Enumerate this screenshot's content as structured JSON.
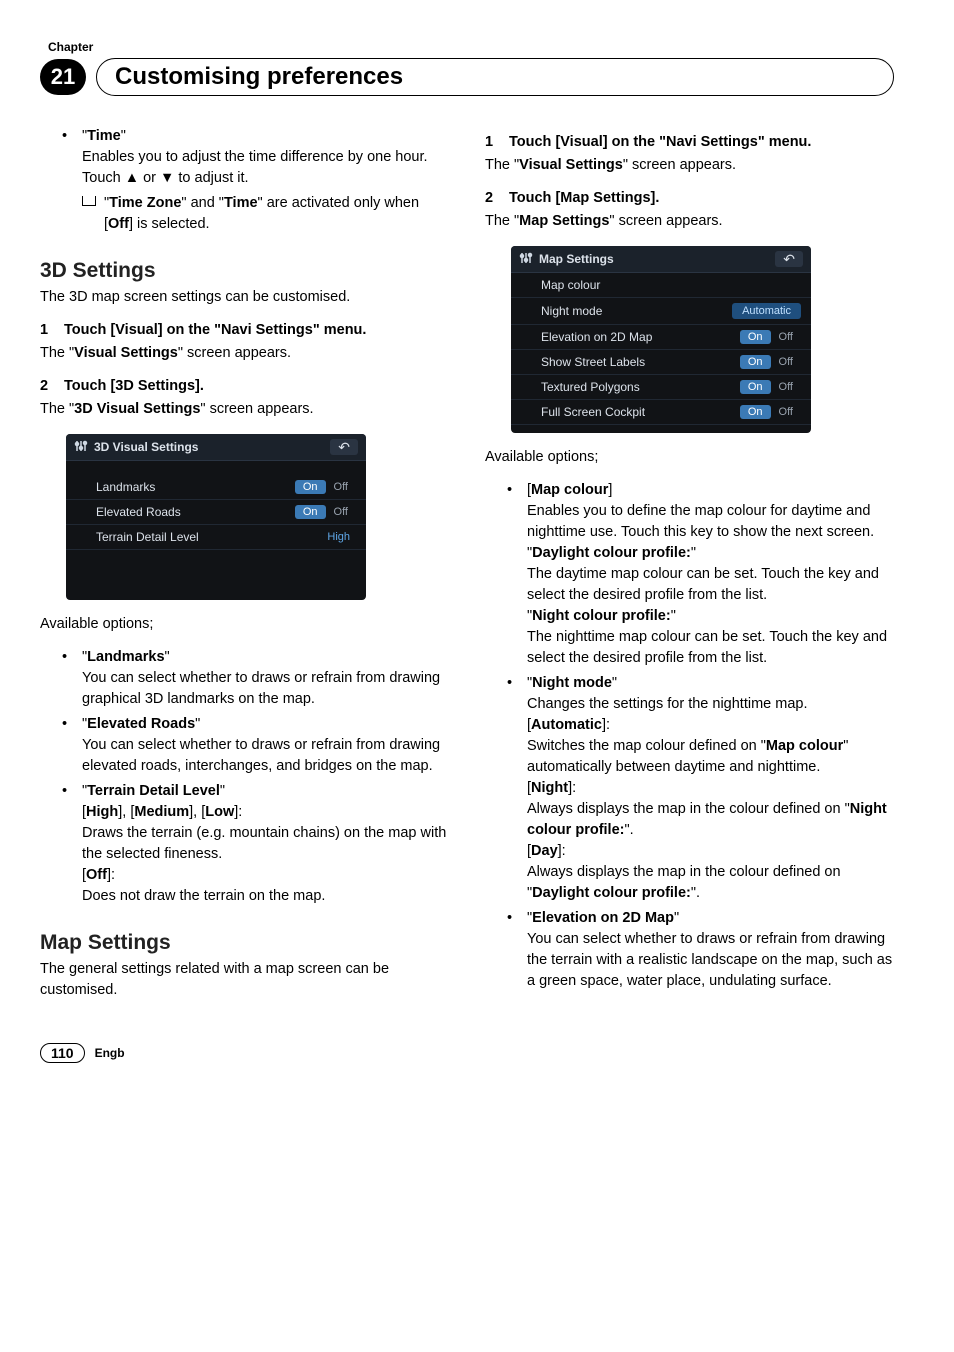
{
  "header": {
    "chapter_label": "Chapter",
    "chapter_number": "21",
    "title": "Customising preferences"
  },
  "left": {
    "time_item": {
      "title": "Time",
      "desc": "Enables you to adjust the time difference by one hour. Touch ▲ or ▼ to adjust it.",
      "sub": "\"Time Zone\" and \"Time\" are activated only when [Off] is selected."
    },
    "sec3d": {
      "heading": "3D Settings",
      "intro": "The 3D map screen settings can be customised.",
      "step1_num": "1",
      "step1_title": "Touch [Visual] on the \"Navi Settings\" menu.",
      "step1_body_a": "The \"",
      "step1_body_b": "Visual Settings",
      "step1_body_c": "\" screen appears.",
      "step2_num": "2",
      "step2_title": "Touch [3D Settings].",
      "step2_body_a": "The \"",
      "step2_body_b": "3D Visual Settings",
      "step2_body_c": "\" screen appears."
    },
    "panel3d": {
      "title": "3D Visual Settings",
      "rows": [
        {
          "label": "Landmarks",
          "type": "toggle",
          "on": "On",
          "off": "Off",
          "active": "on"
        },
        {
          "label": "Elevated Roads",
          "type": "toggle",
          "on": "On",
          "off": "Off",
          "active": "on"
        },
        {
          "label": "Terrain Detail Level",
          "type": "value",
          "value": "High"
        }
      ]
    },
    "avail_label": "Available options;",
    "opts": {
      "landmarks": {
        "title": "Landmarks",
        "desc": "You can select whether to draws or refrain from drawing graphical 3D landmarks on the map."
      },
      "elevated": {
        "title": "Elevated Roads",
        "desc": "You can select whether to draws or refrain from drawing elevated roads, interchanges, and bridges on the map."
      },
      "terrain": {
        "title": "Terrain Detail Level",
        "line1_a": "[",
        "line1_b": "High",
        "line1_c": "], [",
        "line1_d": "Medium",
        "line1_e": "], [",
        "line1_f": "Low",
        "line1_g": "]:",
        "desc1": "Draws the terrain (e.g. mountain chains) on the map with the selected fineness.",
        "off_a": "[",
        "off_b": "Off",
        "off_c": "]:",
        "desc2": "Does not draw the terrain on the map."
      }
    },
    "mapset": {
      "heading": "Map Settings",
      "intro": "The general settings related with a map screen can be customised."
    }
  },
  "right": {
    "step1_num": "1",
    "step1_title": "Touch [Visual] on the \"Navi Settings\" menu.",
    "step1_body_a": "The \"",
    "step1_body_b": "Visual Settings",
    "step1_body_c": "\" screen appears.",
    "step2_num": "2",
    "step2_title": "Touch [Map Settings].",
    "step2_body_a": "The \"",
    "step2_body_b": "Map Settings",
    "step2_body_c": "\" screen appears.",
    "panel": {
      "title": "Map Settings",
      "rows": [
        {
          "label": "Map colour",
          "type": "none"
        },
        {
          "label": "Night mode",
          "type": "auto",
          "value": "Automatic"
        },
        {
          "label": "Elevation on 2D Map",
          "type": "toggle",
          "on": "On",
          "off": "Off",
          "active": "on"
        },
        {
          "label": "Show Street Labels",
          "type": "toggle",
          "on": "On",
          "off": "Off",
          "active": "on"
        },
        {
          "label": "Textured Polygons",
          "type": "toggle",
          "on": "On",
          "off": "Off",
          "active": "on"
        },
        {
          "label": "Full Screen Cockpit",
          "type": "toggle",
          "on": "On",
          "off": "Off",
          "active": "on"
        }
      ]
    },
    "avail_label": "Available options;",
    "mapcolour": {
      "title": "Map colour",
      "desc": "Enables you to define the map colour for daytime and nighttime use. Touch this key to show the next screen.",
      "day_h": "Daylight colour profile:",
      "day_d": "The daytime map colour can be set. Touch the key and select the desired profile from the list.",
      "night_h": "Night colour profile:",
      "night_d": "The nighttime map colour can be set. Touch the key and select the desired profile from the list."
    },
    "nightmode": {
      "title": "Night mode",
      "desc": "Changes the settings for the nighttime map.",
      "auto_a": "[",
      "auto_b": "Automatic",
      "auto_c": "]:",
      "auto_d1": "Switches the map colour defined on \"",
      "auto_d2": "Map colour",
      "auto_d3": "\" automatically between daytime and nighttime.",
      "night_a": "[",
      "night_b": "Night",
      "night_c": "]:",
      "night_d1": "Always displays the map in the colour defined on \"",
      "night_d2": "Night colour profile:",
      "night_d3": "\".",
      "day_a": "[",
      "day_b": "Day",
      "day_c": "]:",
      "day_d1": "Always displays the map in the colour defined on \"",
      "day_d2": "Daylight colour profile:",
      "day_d3": "\"."
    },
    "elev": {
      "title": "Elevation on 2D Map",
      "desc": "You can select whether to draws or refrain from drawing the terrain with a realistic landscape on the map, such as a green space, water place, undulating surface."
    }
  },
  "footer": {
    "page": "110",
    "lang": "Engb"
  }
}
